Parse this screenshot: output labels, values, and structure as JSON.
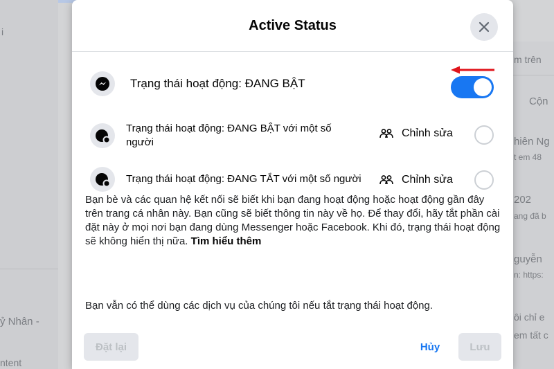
{
  "background": {
    "left_texts": [
      "i",
      "ỷ Nhân -",
      "ntent"
    ],
    "right_texts": [
      "m trên",
      "Cộn",
      "hiên Ng",
      "t em 48",
      "202",
      "ang đã b",
      "guyễn",
      "n: https:",
      "ôi chỉ e",
      "em tất c"
    ]
  },
  "modal": {
    "title": "Active Status",
    "close_label": "Close"
  },
  "main_status": {
    "label": "Trạng thái hoạt động: ĐANG BẬT",
    "toggle_on": true
  },
  "options": [
    {
      "label": "Trạng thái hoạt động: ĐANG BẬT với một số người",
      "edit_label": "Chỉnh sửa",
      "selected": false
    },
    {
      "label": "Trạng thái hoạt động: ĐANG TẮT với một số người",
      "edit_label": "Chỉnh sửa",
      "selected": false
    }
  ],
  "description": {
    "text": "Bạn bè và các quan hệ kết nối sẽ biết khi bạn đang hoạt động hoặc hoạt động gần đây trên trang cá nhân này. Bạn cũng sẽ biết thông tin này về họ. Để thay đổi, hãy tắt phần cài đặt này ở mọi nơi bạn đang dùng Messenger hoặc Facebook. Khi đó, trạng thái hoạt động sẽ không hiển thị nữa.",
    "learn_more": "Tìm hiểu thêm",
    "note": "Bạn vẫn có thể dùng các dịch vụ của chúng tôi nếu tắt trạng thái hoạt động."
  },
  "footer": {
    "reset_label": "Đặt lại",
    "cancel_label": "Hủy",
    "save_label": "Lưu"
  },
  "colors": {
    "accent": "#1877f2",
    "annotation_arrow": "#e0141b",
    "disabled_text": "#bcc0c4"
  },
  "icons": [
    "messenger-icon",
    "close-icon",
    "active-status-icon",
    "people-icon",
    "red-arrow-annotation"
  ]
}
